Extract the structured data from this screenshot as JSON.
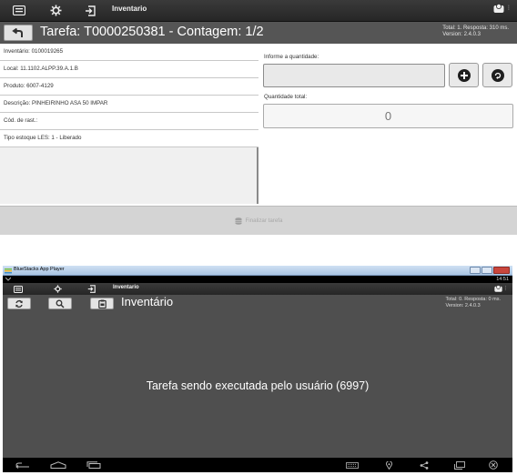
{
  "screen_top": {
    "app_title": "Inventario",
    "task_title": "Tarefa: T0000250381 - Contagem: 1/2",
    "stats": {
      "line1": "Total: 1. Resposta: 310 ms.",
      "line2": "Version: 2.4.0.3"
    },
    "info_rows": [
      "Inventário: 0100019265",
      "Local: 11.1102.ALPP.39.A.1.B",
      "Produto: 6007-4129",
      "Descrição: PINHEIRINHO ASA 50 IMPAR",
      "Cód. de rast.:",
      "Tipo estoque LES: 1 - Liberado"
    ],
    "quantity_label": "Informe a quantidade:",
    "quantity_value": "",
    "total_label": "Quantidade total:",
    "total_value": "0",
    "finalize_label": "Finalizar tarefa",
    "icons": [
      "menu-icon",
      "settings-icon",
      "logout-icon",
      "back-icon",
      "plus-icon",
      "recycle-icon",
      "user-icon",
      "database-icon"
    ]
  },
  "screen_bottom": {
    "window_title": "BlueStacks App Player",
    "clock": "14:51",
    "app_title": "Inventario",
    "page_title": "Inventário",
    "stats": {
      "line1": "Total: 0. Resposta: 0 ms.",
      "line2": "Version: 2.4.0.3"
    },
    "message": "Tarefa sendo executada pelo usuário (6997)",
    "icons": [
      "refresh-icon",
      "search-icon",
      "clipboard-icon",
      "back-nav-icon",
      "home-nav-icon",
      "recents-nav-icon",
      "keyboard-icon",
      "location-icon",
      "share-icon",
      "screen-icon",
      "close-icon"
    ]
  },
  "colors": {
    "actionbar": "#2f2f2f",
    "titlebar": "#555555",
    "bluestacks_bg": "#4f4f4f",
    "panel_bg": "#f0f0f0"
  }
}
